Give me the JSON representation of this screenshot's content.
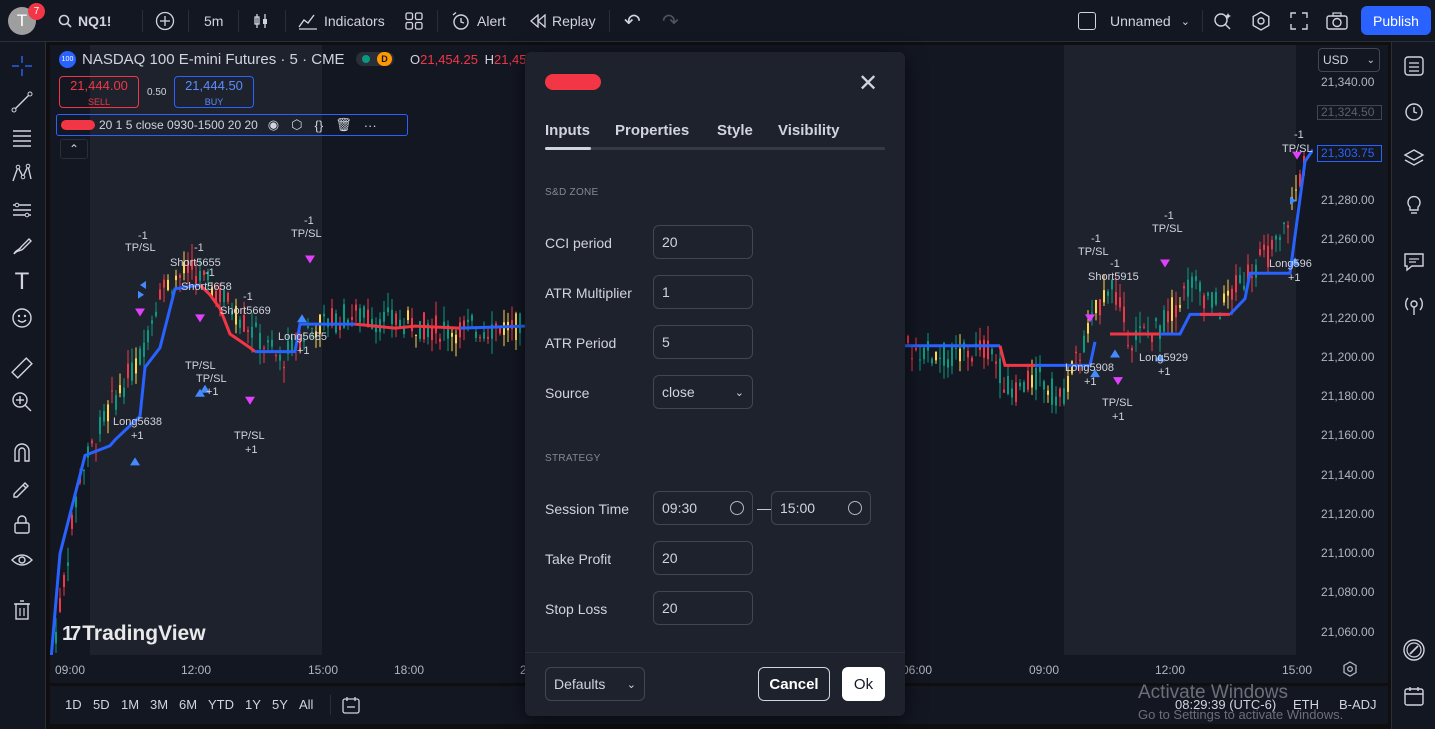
{
  "topbar": {
    "avatar_letter": "T",
    "notif_count": "7",
    "symbol": "NQ1!",
    "interval": "5m",
    "indicators": "Indicators",
    "alert": "Alert",
    "replay": "Replay",
    "layout_name": "Unnamed",
    "publish": "Publish"
  },
  "legend": {
    "logo": "100",
    "title": "NASDAQ 100 E-mini Futures · 5 · CME",
    "flag": "D",
    "open_label": "O",
    "open_value": "21,454.25",
    "high_label": "H",
    "high_value": "21,45",
    "sell_price": "21,444.00",
    "sell_label": "SELL",
    "spread": "0.50",
    "buy_price": "21,444.50",
    "buy_label": "BUY",
    "indicator_params": "20 1 5 close 0930-1500 20 20"
  },
  "price_scale": {
    "currency": "USD",
    "ticks": [
      "21,340.00",
      "21,320.00",
      "21,300.00",
      "21,280.00",
      "21,260.00",
      "21,240.00",
      "21,220.00",
      "21,200.00",
      "21,180.00",
      "21,160.00",
      "21,140.00",
      "21,120.00",
      "21,100.00",
      "21,080.00",
      "21,060.00"
    ],
    "mark1": "21,324.50",
    "mark2": "21,303.75"
  },
  "time_scale": {
    "ticks": [
      "09:00",
      "12:00",
      "15:00",
      "18:00",
      "2",
      "06:00",
      "09:00",
      "12:00",
      "15:00"
    ]
  },
  "bottom": {
    "ranges": [
      "1D",
      "5D",
      "1M",
      "3M",
      "6M",
      "YTD",
      "1Y",
      "5Y",
      "All"
    ],
    "clock": "08:29:39 (UTC-6)",
    "session": "ETH",
    "adj": "B-ADJ"
  },
  "chart_labels": {
    "tpsl": "TP/SL",
    "minus1": "-1",
    "plus1": "+1",
    "l1": "Long5638",
    "s1": "Short5655",
    "s2": "Short5658",
    "s3": "Short5669",
    "l2": "Long5685",
    "l3": "Long5908",
    "s4": "Short5915",
    "l4": "Long5929",
    "l5": "Long596",
    "brand": "TradingView"
  },
  "dialog": {
    "tabs": [
      "Inputs",
      "Properties",
      "Style",
      "Visibility"
    ],
    "section1": "S&D ZONE",
    "cci_label": "CCI period",
    "cci_value": "20",
    "atrm_label": "ATR Multiplier",
    "atrm_value": "1",
    "atrp_label": "ATR Period",
    "atrp_value": "5",
    "source_label": "Source",
    "source_value": "close",
    "section2": "STRATEGY",
    "session_label": "Session Time",
    "session_start": "09:30",
    "session_dash": "—",
    "session_end": "15:00",
    "tp_label": "Take Profit",
    "tp_value": "20",
    "sl_label": "Stop Loss",
    "sl_value": "20",
    "defaults": "Defaults",
    "cancel": "Cancel",
    "ok": "Ok"
  },
  "watermark": {
    "line1": "Activate Windows",
    "line2": "Go to Settings to activate Windows."
  },
  "colors": {
    "bg": "#131722",
    "accent": "#2962ff",
    "down": "#f23645",
    "up": "#089981",
    "signal": "#e040fb"
  }
}
